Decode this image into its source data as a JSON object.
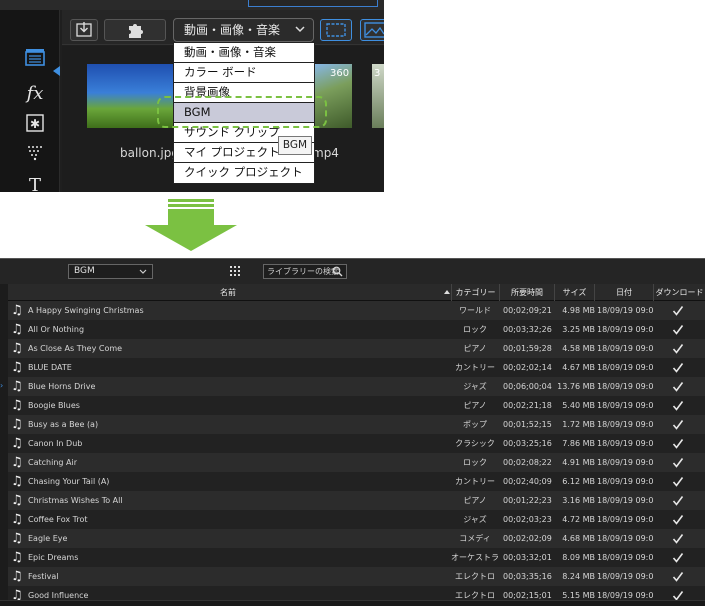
{
  "top": {
    "filter_value": "動画・画像・音楽",
    "dropdown_options": [
      "動画・画像・音楽",
      "カラー ボード",
      "背景画像",
      "BGM",
      "サウンド クリップ",
      "マイ プロジェクト",
      "クイック プロジェクト"
    ],
    "selected_option": "BGM",
    "tooltip": "BGM",
    "thumb_labels": [
      "ballon.jpg",
      "mp4"
    ],
    "badge_360": "360",
    "badge_partial": "3",
    "side_icons": [
      "media-icon",
      "fx-icon",
      "particle-icon",
      "transition-icon",
      "title-icon"
    ],
    "fx_label": "fx",
    "title_label": "T"
  },
  "bottom": {
    "category_select": "BGM",
    "search_placeholder": "ライブラリーの検索",
    "columns": {
      "name": "名前",
      "category": "カテゴリー",
      "duration": "所要時間",
      "size": "サイズ",
      "date": "日付",
      "download": "ダウンロード"
    },
    "rows": [
      {
        "name": "A Happy Swinging Christmas",
        "category": "ワールド",
        "duration": "00;02;09;21",
        "size": "4.98 MB",
        "date": "18/09/19 09:00"
      },
      {
        "name": "All Or Nothing",
        "category": "ロック",
        "duration": "00;03;32;26",
        "size": "3.25 MB",
        "date": "18/09/19 09:00"
      },
      {
        "name": "As Close As They Come",
        "category": "ピアノ",
        "duration": "00;01;59;28",
        "size": "4.58 MB",
        "date": "18/09/19 09:00"
      },
      {
        "name": "BLUE DATE",
        "category": "カントリー",
        "duration": "00;02;02;14",
        "size": "4.67 MB",
        "date": "18/09/19 09:00"
      },
      {
        "name": "Blue Horns Drive",
        "category": "ジャズ",
        "duration": "00;06;00;04",
        "size": "13.76 MB",
        "date": "18/09/19 09:00"
      },
      {
        "name": "Boogie Blues",
        "category": "ピアノ",
        "duration": "00;02;21;18",
        "size": "5.40 MB",
        "date": "18/09/19 09:00"
      },
      {
        "name": "Busy as a Bee (a)",
        "category": "ポップ",
        "duration": "00;01;52;15",
        "size": "1.72 MB",
        "date": "18/09/19 09:00"
      },
      {
        "name": "Canon In Dub",
        "category": "クラシック",
        "duration": "00;03;25;16",
        "size": "7.86 MB",
        "date": "18/09/19 09:00"
      },
      {
        "name": "Catching Air",
        "category": "ロック",
        "duration": "00;02;08;22",
        "size": "4.91 MB",
        "date": "18/09/19 09:00"
      },
      {
        "name": "Chasing Your Tail (A)",
        "category": "カントリー",
        "duration": "00;02;40;09",
        "size": "6.12 MB",
        "date": "18/09/19 09:00"
      },
      {
        "name": "Christmas Wishes To All",
        "category": "ピアノ",
        "duration": "00;01;22;23",
        "size": "3.16 MB",
        "date": "18/09/19 09:00"
      },
      {
        "name": "Coffee Fox Trot",
        "category": "ジャズ",
        "duration": "00;02;03;23",
        "size": "4.72 MB",
        "date": "18/09/19 09:00"
      },
      {
        "name": "Eagle Eye",
        "category": "コメディ",
        "duration": "00;02;02;09",
        "size": "4.68 MB",
        "date": "18/09/19 09:00"
      },
      {
        "name": "Epic Dreams",
        "category": "オーケストラ",
        "duration": "00;03;32;01",
        "size": "8.09 MB",
        "date": "18/09/19 09:00"
      },
      {
        "name": "Festival",
        "category": "エレクトロ",
        "duration": "00;03;35;16",
        "size": "8.24 MB",
        "date": "18/09/19 09:00"
      },
      {
        "name": "Good Influence",
        "category": "エレクトロ",
        "duration": "00;02;15;01",
        "size": "5.15 MB",
        "date": "18/09/19 09:00"
      }
    ]
  },
  "colors": {
    "accent_green": "#7bc142",
    "accent_blue": "#3f8fe0",
    "selected_row": "#c9cad9"
  }
}
